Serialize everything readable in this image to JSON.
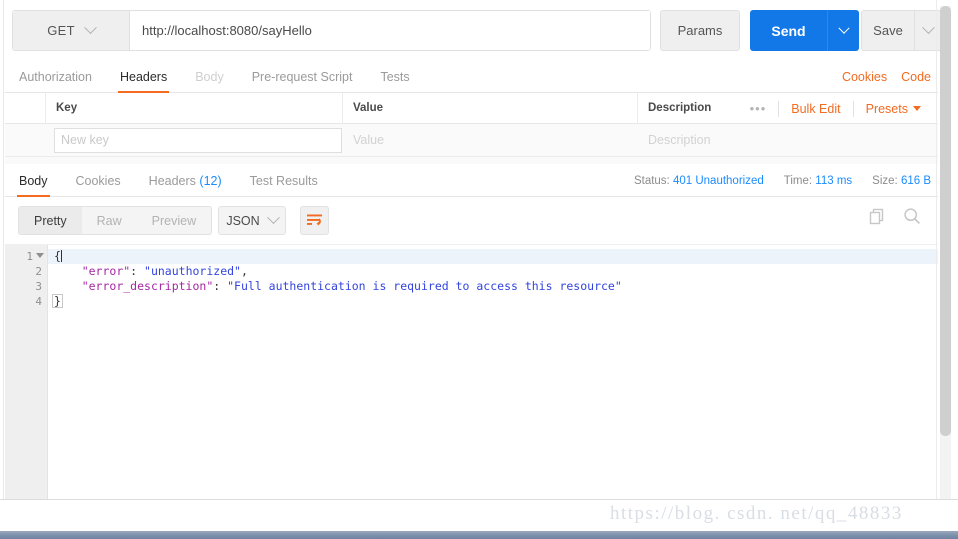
{
  "request": {
    "method": "GET",
    "url": "http://localhost:8080/sayHello",
    "params_label": "Params",
    "send_label": "Send",
    "save_label": "Save",
    "tabs": [
      {
        "label": "Authorization",
        "state": "normal"
      },
      {
        "label": "Headers",
        "state": "active"
      },
      {
        "label": "Body",
        "state": "dim"
      },
      {
        "label": "Pre-request Script",
        "state": "normal"
      },
      {
        "label": "Tests",
        "state": "normal"
      }
    ],
    "links": [
      {
        "label": "Cookies"
      },
      {
        "label": "Code"
      }
    ]
  },
  "headers_table": {
    "columns": [
      "Key",
      "Value",
      "Description"
    ],
    "tools": {
      "dots": "•••",
      "bulk_edit": "Bulk Edit",
      "presets": "Presets"
    },
    "new_row": {
      "key_placeholder": "New key",
      "value_placeholder": "Value",
      "description_placeholder": "Description",
      "key_value": ""
    }
  },
  "response": {
    "tabs": [
      {
        "label": "Body",
        "state": "active",
        "count": ""
      },
      {
        "label": "Cookies",
        "state": "normal",
        "count": ""
      },
      {
        "label": "Headers",
        "state": "normal",
        "count": "(12)"
      },
      {
        "label": "Test Results",
        "state": "normal",
        "count": ""
      }
    ],
    "status": {
      "status_label": "Status:",
      "status_value": "401 Unauthorized",
      "time_label": "Time:",
      "time_value": "113 ms",
      "size_label": "Size:",
      "size_value": "616 B"
    },
    "toolbar": {
      "views": [
        {
          "label": "Pretty",
          "state": "on"
        },
        {
          "label": "Raw",
          "state": "off"
        },
        {
          "label": "Preview",
          "state": "off"
        }
      ],
      "format": "JSON",
      "wrap_icon": "word-wrap-icon",
      "copy_icon": "copy-icon",
      "search_icon": "search-icon"
    },
    "body": {
      "language": "json",
      "lines": [
        {
          "num": "1",
          "foldable": true,
          "segments": [
            {
              "t": "{",
              "c": "p"
            }
          ]
        },
        {
          "num": "2",
          "foldable": false,
          "segments": [
            {
              "t": "    ",
              "c": "p"
            },
            {
              "t": "\"error\"",
              "c": "k"
            },
            {
              "t": ": ",
              "c": "p"
            },
            {
              "t": "\"unauthorized\"",
              "c": "s"
            },
            {
              "t": ",",
              "c": "p"
            }
          ]
        },
        {
          "num": "3",
          "foldable": false,
          "segments": [
            {
              "t": "    ",
              "c": "p"
            },
            {
              "t": "\"error_description\"",
              "c": "k"
            },
            {
              "t": ": ",
              "c": "p"
            },
            {
              "t": "\"Full authentication is required to access this resource\"",
              "c": "s"
            }
          ]
        },
        {
          "num": "4",
          "foldable": false,
          "segments": [
            {
              "t": "}",
              "c": "p"
            }
          ]
        }
      ],
      "raw_text": "{\n    \"error\": \"unauthorized\",\n    \"error_description\": \"Full authentication is required to access this resource\"\n}"
    }
  },
  "watermark": {
    "text": "https://blog. csdn. net/qq_48833"
  },
  "colors": {
    "accent_orange": "#f26b21",
    "send_blue": "#1278e8",
    "status_blue": "#1a8cff",
    "json_key": "#a626a4",
    "json_string": "#3344dd"
  }
}
